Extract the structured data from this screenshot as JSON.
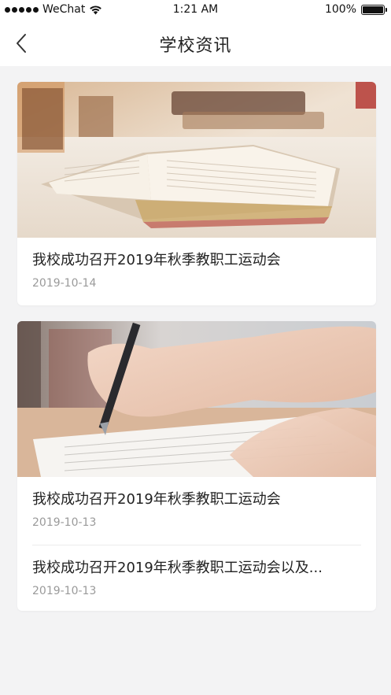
{
  "status_bar": {
    "carrier": "WeChat",
    "time": "1:21 AM",
    "battery": "100%",
    "signal_icon": "signal-dots-icon",
    "wifi_icon": "wifi-icon",
    "battery_icon": "battery-icon"
  },
  "nav": {
    "title": "学校资讯",
    "back_icon": "chevron-left-icon"
  },
  "cards": [
    {
      "image": "open-book-photo",
      "articles": [
        {
          "title": "我校成功召开2019年秋季教职工运动会",
          "date": "2019-10-14"
        }
      ]
    },
    {
      "image": "hand-writing-photo",
      "articles": [
        {
          "title": "我校成功召开2019年秋季教职工运动会",
          "date": "2019-10-13"
        },
        {
          "title": "我校成功召开2019年秋季教职工运动会以及...",
          "date": "2019-10-13"
        }
      ]
    }
  ],
  "colors": {
    "background": "#f3f3f4",
    "card": "#ffffff",
    "title_text": "#222222",
    "date_text": "#9a9a9a"
  }
}
